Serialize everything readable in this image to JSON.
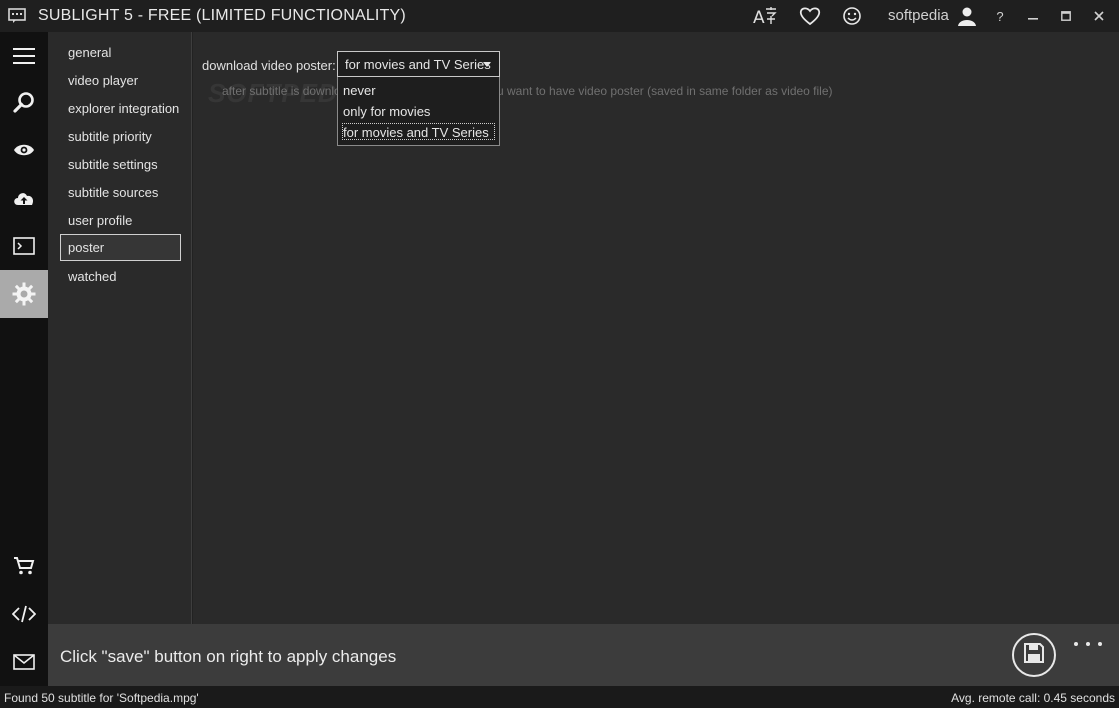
{
  "window": {
    "title": "SUBLIGHT 5 - FREE (LIMITED FUNCTIONALITY)",
    "username": "softpedia",
    "help_label": "?",
    "minimize_label": "▬",
    "maximize_label": "☐",
    "close_label": "✕"
  },
  "leftnav": {
    "icons": [
      "menu-icon",
      "search-icon",
      "eye-icon",
      "cloud-upload-icon",
      "terminal-icon",
      "gear-icon",
      "cart-icon",
      "code-icon",
      "mail-icon"
    ],
    "active": "gear-icon"
  },
  "settings": {
    "items": [
      {
        "label": "general"
      },
      {
        "label": "video player"
      },
      {
        "label": "explorer integration"
      },
      {
        "label": "subtitle priority"
      },
      {
        "label": "subtitle settings"
      },
      {
        "label": "subtitle sources"
      },
      {
        "label": "user profile"
      },
      {
        "label": "poster"
      },
      {
        "label": "watched"
      }
    ],
    "selected": "poster"
  },
  "content": {
    "field_label": "download video poster:",
    "combo_value": "for movies and TV Series",
    "options": [
      "never",
      "only for movies",
      "for movies and TV Series"
    ],
    "hint_left": "after subtitle is downlo",
    "hint_right": "u want to have video poster (saved in same folder as video file)",
    "watermark": "SOFTPEDIA"
  },
  "bottom": {
    "message": "Click \"save\" button on right to apply changes"
  },
  "status": {
    "left": "Found 50 subtitle for 'Softpedia.mpg'",
    "right": "Avg. remote call: 0.45 seconds"
  },
  "colors": {
    "background": "#222222",
    "panel": "#2a2a2a",
    "nav": "#111111",
    "active_nav": "#aaaaaa",
    "bottom_bar": "#3c3c3c"
  }
}
